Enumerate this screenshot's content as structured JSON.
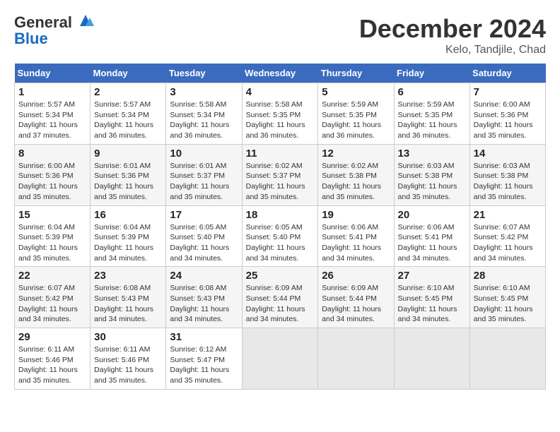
{
  "header": {
    "logo_line1": "General",
    "logo_line2": "Blue",
    "month_title": "December 2024",
    "location": "Kelo, Tandjile, Chad"
  },
  "weekdays": [
    "Sunday",
    "Monday",
    "Tuesday",
    "Wednesday",
    "Thursday",
    "Friday",
    "Saturday"
  ],
  "weeks": [
    [
      {
        "day": "1",
        "text": "Sunrise: 5:57 AM\nSunset: 5:34 PM\nDaylight: 11 hours\nand 37 minutes."
      },
      {
        "day": "2",
        "text": "Sunrise: 5:57 AM\nSunset: 5:34 PM\nDaylight: 11 hours\nand 36 minutes."
      },
      {
        "day": "3",
        "text": "Sunrise: 5:58 AM\nSunset: 5:34 PM\nDaylight: 11 hours\nand 36 minutes."
      },
      {
        "day": "4",
        "text": "Sunrise: 5:58 AM\nSunset: 5:35 PM\nDaylight: 11 hours\nand 36 minutes."
      },
      {
        "day": "5",
        "text": "Sunrise: 5:59 AM\nSunset: 5:35 PM\nDaylight: 11 hours\nand 36 minutes."
      },
      {
        "day": "6",
        "text": "Sunrise: 5:59 AM\nSunset: 5:35 PM\nDaylight: 11 hours\nand 36 minutes."
      },
      {
        "day": "7",
        "text": "Sunrise: 6:00 AM\nSunset: 5:36 PM\nDaylight: 11 hours\nand 35 minutes."
      }
    ],
    [
      {
        "day": "8",
        "text": "Sunrise: 6:00 AM\nSunset: 5:36 PM\nDaylight: 11 hours\nand 35 minutes."
      },
      {
        "day": "9",
        "text": "Sunrise: 6:01 AM\nSunset: 5:36 PM\nDaylight: 11 hours\nand 35 minutes."
      },
      {
        "day": "10",
        "text": "Sunrise: 6:01 AM\nSunset: 5:37 PM\nDaylight: 11 hours\nand 35 minutes."
      },
      {
        "day": "11",
        "text": "Sunrise: 6:02 AM\nSunset: 5:37 PM\nDaylight: 11 hours\nand 35 minutes."
      },
      {
        "day": "12",
        "text": "Sunrise: 6:02 AM\nSunset: 5:38 PM\nDaylight: 11 hours\nand 35 minutes."
      },
      {
        "day": "13",
        "text": "Sunrise: 6:03 AM\nSunset: 5:38 PM\nDaylight: 11 hours\nand 35 minutes."
      },
      {
        "day": "14",
        "text": "Sunrise: 6:03 AM\nSunset: 5:38 PM\nDaylight: 11 hours\nand 35 minutes."
      }
    ],
    [
      {
        "day": "15",
        "text": "Sunrise: 6:04 AM\nSunset: 5:39 PM\nDaylight: 11 hours\nand 35 minutes."
      },
      {
        "day": "16",
        "text": "Sunrise: 6:04 AM\nSunset: 5:39 PM\nDaylight: 11 hours\nand 34 minutes."
      },
      {
        "day": "17",
        "text": "Sunrise: 6:05 AM\nSunset: 5:40 PM\nDaylight: 11 hours\nand 34 minutes."
      },
      {
        "day": "18",
        "text": "Sunrise: 6:05 AM\nSunset: 5:40 PM\nDaylight: 11 hours\nand 34 minutes."
      },
      {
        "day": "19",
        "text": "Sunrise: 6:06 AM\nSunset: 5:41 PM\nDaylight: 11 hours\nand 34 minutes."
      },
      {
        "day": "20",
        "text": "Sunrise: 6:06 AM\nSunset: 5:41 PM\nDaylight: 11 hours\nand 34 minutes."
      },
      {
        "day": "21",
        "text": "Sunrise: 6:07 AM\nSunset: 5:42 PM\nDaylight: 11 hours\nand 34 minutes."
      }
    ],
    [
      {
        "day": "22",
        "text": "Sunrise: 6:07 AM\nSunset: 5:42 PM\nDaylight: 11 hours\nand 34 minutes."
      },
      {
        "day": "23",
        "text": "Sunrise: 6:08 AM\nSunset: 5:43 PM\nDaylight: 11 hours\nand 34 minutes."
      },
      {
        "day": "24",
        "text": "Sunrise: 6:08 AM\nSunset: 5:43 PM\nDaylight: 11 hours\nand 34 minutes."
      },
      {
        "day": "25",
        "text": "Sunrise: 6:09 AM\nSunset: 5:44 PM\nDaylight: 11 hours\nand 34 minutes."
      },
      {
        "day": "26",
        "text": "Sunrise: 6:09 AM\nSunset: 5:44 PM\nDaylight: 11 hours\nand 34 minutes."
      },
      {
        "day": "27",
        "text": "Sunrise: 6:10 AM\nSunset: 5:45 PM\nDaylight: 11 hours\nand 34 minutes."
      },
      {
        "day": "28",
        "text": "Sunrise: 6:10 AM\nSunset: 5:45 PM\nDaylight: 11 hours\nand 35 minutes."
      }
    ],
    [
      {
        "day": "29",
        "text": "Sunrise: 6:11 AM\nSunset: 5:46 PM\nDaylight: 11 hours\nand 35 minutes."
      },
      {
        "day": "30",
        "text": "Sunrise: 6:11 AM\nSunset: 5:46 PM\nDaylight: 11 hours\nand 35 minutes."
      },
      {
        "day": "31",
        "text": "Sunrise: 6:12 AM\nSunset: 5:47 PM\nDaylight: 11 hours\nand 35 minutes."
      },
      {
        "day": "",
        "text": ""
      },
      {
        "day": "",
        "text": ""
      },
      {
        "day": "",
        "text": ""
      },
      {
        "day": "",
        "text": ""
      }
    ]
  ]
}
